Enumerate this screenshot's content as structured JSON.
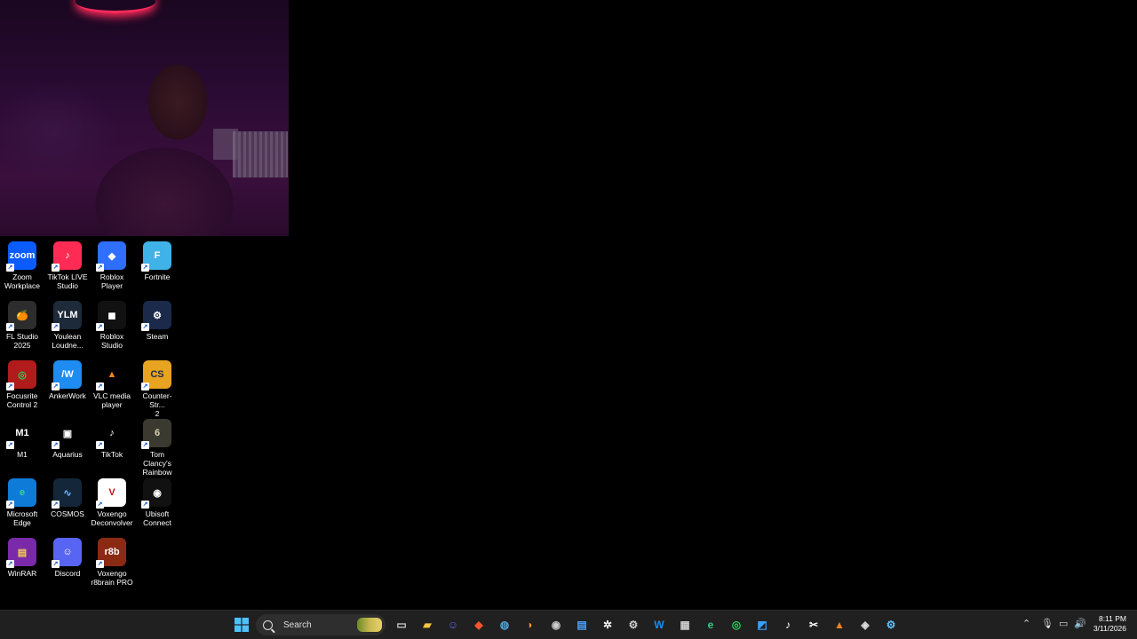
{
  "desktop": {
    "icons": [
      {
        "label": "Zoom\nWorkplace",
        "icon": "zoom-icon",
        "glyph": "zoom",
        "bg": "#0b5cff",
        "fg": "#ffffff"
      },
      {
        "label": "TikTok LIVE\nStudio",
        "icon": "tiktok-live-icon",
        "glyph": "♪",
        "bg": "#fe2c55",
        "fg": "#ffffff"
      },
      {
        "label": "Roblox Player",
        "icon": "roblox-player-icon",
        "glyph": "◆",
        "bg": "#2f6fff",
        "fg": "#ffffff"
      },
      {
        "label": "Fortnite",
        "icon": "fortnite-icon",
        "glyph": "F",
        "bg": "#3fb3e8",
        "fg": "#ffffff"
      },
      {
        "label": "FL Studio\n2025",
        "icon": "fl-studio-icon",
        "glyph": "🍊",
        "bg": "#2d2d2d",
        "fg": "#f7941d"
      },
      {
        "label": "Youlean\nLoudne...",
        "icon": "youlean-icon",
        "glyph": "YLM",
        "bg": "#1d2a3a",
        "fg": "#ffffff"
      },
      {
        "label": "Roblox\nStudio",
        "icon": "roblox-studio-icon",
        "glyph": "◼",
        "bg": "#111111",
        "fg": "#ffffff"
      },
      {
        "label": "Steam",
        "icon": "steam-icon",
        "glyph": "⚙",
        "bg": "#1b2a4a",
        "fg": "#ffffff"
      },
      {
        "label": "Focusrite\nControl 2",
        "icon": "focusrite-icon",
        "glyph": "◎",
        "bg": "#b11b1b",
        "fg": "#2ad15a"
      },
      {
        "label": "AnkerWork",
        "icon": "ankerwork-icon",
        "glyph": "/W",
        "bg": "#1e8cf0",
        "fg": "#ffffff"
      },
      {
        "label": "VLC media\nplayer",
        "icon": "vlc-icon",
        "glyph": "▲",
        "bg": "#000000",
        "fg": "#f58220"
      },
      {
        "label": "Counter-Str...\n2",
        "icon": "counter-strike-icon",
        "glyph": "CS",
        "bg": "#e8a321",
        "fg": "#1b2a4a"
      },
      {
        "label": "M1",
        "icon": "m1-icon",
        "glyph": "M1",
        "bg": "#000000",
        "fg": "#ffffff"
      },
      {
        "label": "Aquarius",
        "icon": "aquarius-icon",
        "glyph": "▣",
        "bg": "#000000",
        "fg": "#ffffff"
      },
      {
        "label": "TikTok",
        "icon": "tiktok-icon",
        "glyph": "♪",
        "bg": "#000000",
        "fg": "#ffffff"
      },
      {
        "label": "Tom Clancy's\nRainbow Si...",
        "icon": "rainbow-six-icon",
        "glyph": "6",
        "bg": "#3a3a30",
        "fg": "#d8d0b0"
      },
      {
        "label": "Microsoft\nEdge",
        "icon": "edge-icon",
        "glyph": "e",
        "bg": "#0f7bd8",
        "fg": "#39d98a"
      },
      {
        "label": "COSMOS",
        "icon": "cosmos-icon",
        "glyph": "∿",
        "bg": "#14263a",
        "fg": "#6fb6ff"
      },
      {
        "label": "Voxengo\nDeconvolver",
        "icon": "voxengo-deconvolver-icon",
        "glyph": "V",
        "bg": "#ffffff",
        "fg": "#c0111a"
      },
      {
        "label": "Ubisoft\nConnect",
        "icon": "ubisoft-icon",
        "glyph": "◉",
        "bg": "#111111",
        "fg": "#ffffff"
      },
      {
        "label": "WinRAR",
        "icon": "winrar-icon",
        "glyph": "▤",
        "bg": "#7a2aa8",
        "fg": "#f2d24a"
      },
      {
        "label": "Discord",
        "icon": "discord-icon",
        "glyph": "☺",
        "bg": "#5865f2",
        "fg": "#ffffff"
      },
      {
        "label": "Voxengo\nr8brain PRO",
        "icon": "voxengo-r8brain-icon",
        "glyph": "r8b",
        "bg": "#8a2a12",
        "fg": "#ffffff"
      }
    ]
  },
  "taskbar": {
    "search_label": "Search",
    "apps": [
      {
        "icon": "task-view-icon",
        "glyph": "▭",
        "color": "#cfcfcf"
      },
      {
        "icon": "file-explorer-icon",
        "glyph": "▰",
        "color": "#f3c643"
      },
      {
        "icon": "discord-icon",
        "glyph": "☺",
        "color": "#5865f2"
      },
      {
        "icon": "brave-icon",
        "glyph": "◆",
        "color": "#fb542b"
      },
      {
        "icon": "globe-icon",
        "glyph": "◍",
        "color": "#4fa3d8"
      },
      {
        "icon": "fl-studio-icon",
        "glyph": "◗",
        "color": "#f7941d"
      },
      {
        "icon": "obs-icon",
        "glyph": "◉",
        "color": "#cccccc"
      },
      {
        "icon": "notepad-icon",
        "glyph": "▤",
        "color": "#4aa3ff"
      },
      {
        "icon": "chatgpt-icon",
        "glyph": "✲",
        "color": "#ffffff"
      },
      {
        "icon": "settings-icon",
        "glyph": "⚙",
        "color": "#cfcfcf"
      },
      {
        "icon": "ankerwork-icon",
        "glyph": "W",
        "color": "#1e8cf0"
      },
      {
        "icon": "calculator-icon",
        "glyph": "▦",
        "color": "#cfcfcf"
      },
      {
        "icon": "edge-icon",
        "glyph": "e",
        "color": "#2ed28a"
      },
      {
        "icon": "focusrite-icon",
        "glyph": "◎",
        "color": "#2ad15a"
      },
      {
        "icon": "photos-icon",
        "glyph": "◩",
        "color": "#3aa0ff"
      },
      {
        "icon": "tiktok-icon",
        "glyph": "♪",
        "color": "#ffffff"
      },
      {
        "icon": "capcut-icon",
        "glyph": "✂",
        "color": "#ffffff"
      },
      {
        "icon": "vlc-icon",
        "glyph": "▲",
        "color": "#f58220"
      },
      {
        "icon": "unity-icon",
        "glyph": "◈",
        "color": "#dddddd"
      },
      {
        "icon": "steam-icon",
        "glyph": "⚙",
        "color": "#66c0f4"
      }
    ],
    "time": "8:11 PM",
    "date": "3/11/2026"
  }
}
